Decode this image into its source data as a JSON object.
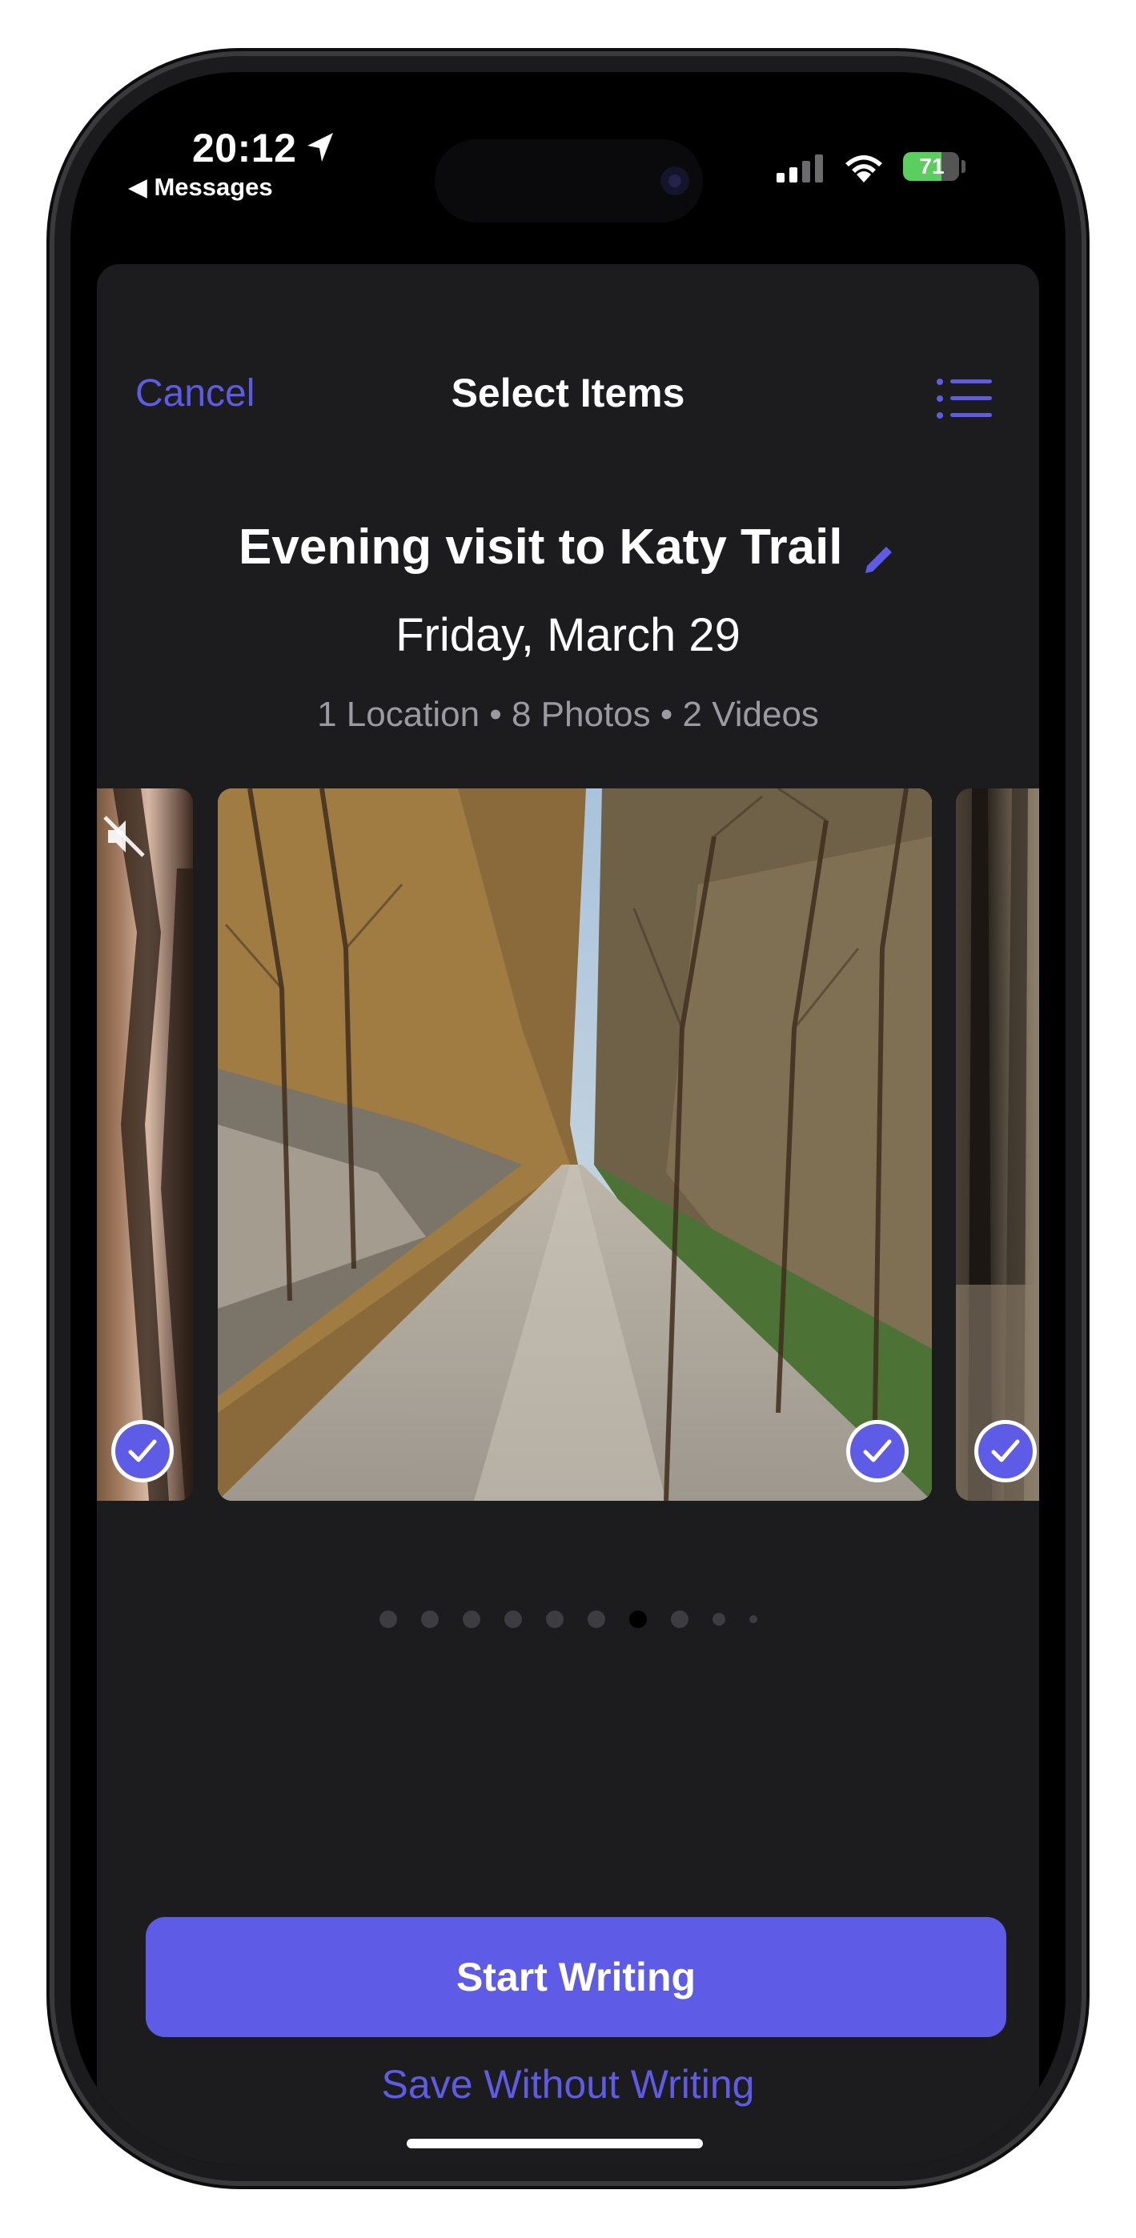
{
  "status_bar": {
    "time": "20:12",
    "back_label": "◀ Messages",
    "battery": "71",
    "location_icon": "location-arrow-icon",
    "signal_icon": "cellular-signal-icon",
    "wifi_icon": "wifi-icon",
    "battery_icon": "battery-charging-icon"
  },
  "nav": {
    "cancel_label": "Cancel",
    "title": "Select Items",
    "list_icon": "list-icon"
  },
  "entry": {
    "title": "Evening visit to Katy Trail",
    "date": "Friday, March 29",
    "meta": "1 Location • 8 Photos • 2 Videos",
    "edit_icon": "pencil-icon"
  },
  "carousel": {
    "items": [
      {
        "kind": "video",
        "selected": true,
        "icons": [
          "mute-icon",
          "checkmark-icon"
        ]
      },
      {
        "kind": "photo",
        "selected": true,
        "icons": [
          "checkmark-icon"
        ]
      },
      {
        "kind": "photo",
        "selected": true,
        "icons": [
          "checkmark-icon"
        ]
      }
    ],
    "page_count": 10,
    "current_page": 7
  },
  "actions": {
    "primary_label": "Start Writing",
    "secondary_label": "Save Without Writing"
  },
  "colors": {
    "accent": "#5e5ce6",
    "sheet_background": "#1c1c1e",
    "battery": "#5acf5f"
  }
}
